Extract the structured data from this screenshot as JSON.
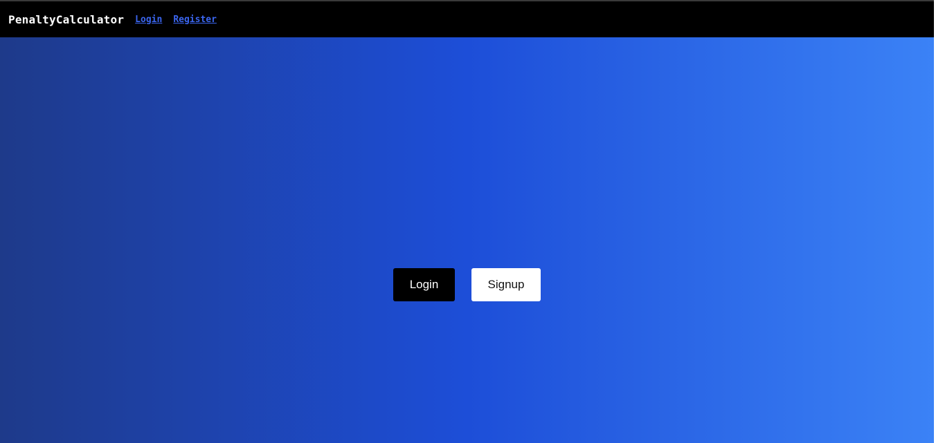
{
  "navbar": {
    "brand": "PenaltyCalculator",
    "links": [
      {
        "label": "Login"
      },
      {
        "label": "Register"
      }
    ]
  },
  "hero": {
    "login_label": "Login",
    "signup_label": "Signup"
  },
  "colors": {
    "navbar_bg": "#000000",
    "link": "#3b66f0",
    "gradient_start": "#1e3a8a",
    "gradient_mid": "#1d4ed8",
    "gradient_end": "#3b82f6",
    "login_button_bg": "#000000",
    "signup_button_bg": "#ffffff"
  }
}
